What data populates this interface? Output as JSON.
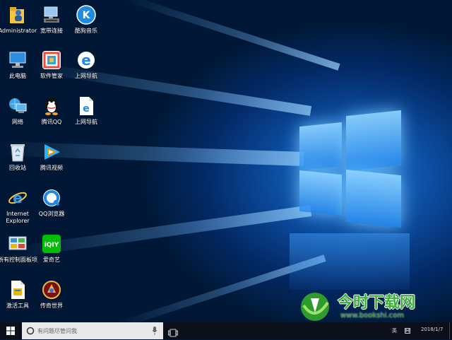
{
  "desktop_icons": [
    {
      "label": "Administrator",
      "icon": "user-folder-icon"
    },
    {
      "label": "宽带连接",
      "icon": "broadband-icon"
    },
    {
      "label": "酷狗音乐",
      "icon": "kugou-icon"
    },
    {
      "label": "此电脑",
      "icon": "computer-icon"
    },
    {
      "label": "软件管家",
      "icon": "software-manager-icon"
    },
    {
      "label": "上网导航",
      "icon": "ie-icon"
    },
    {
      "label": "网络",
      "icon": "network-icon"
    },
    {
      "label": "腾讯QQ",
      "icon": "qq-icon"
    },
    {
      "label": "上网导航",
      "icon": "ie-shortcut-icon"
    },
    {
      "label": "回收站",
      "icon": "recycle-bin-icon"
    },
    {
      "label": "腾讯视频",
      "icon": "tencent-video-icon"
    },
    {
      "label": "Internet Explorer",
      "icon": "internet-explorer-icon"
    },
    {
      "label": "QQ浏览器",
      "icon": "qq-browser-icon"
    },
    {
      "label": "所有控制面板项",
      "icon": "control-panel-icon"
    },
    {
      "label": "爱奇艺",
      "icon": "iqiyi-icon"
    },
    {
      "label": "激活工具",
      "icon": "activation-tool-icon"
    },
    {
      "label": "传奇世界",
      "icon": "legend-world-icon"
    }
  ],
  "taskbar": {
    "search_placeholder": "有问题尽管问我",
    "ime": "英",
    "date": "2018/1/7"
  },
  "watermark": {
    "brand": "今时下载网",
    "url": "www.bookshi.com"
  },
  "colors": {
    "accent_blue": "#1e88e5",
    "watermark_green": "#2e9b2e"
  }
}
